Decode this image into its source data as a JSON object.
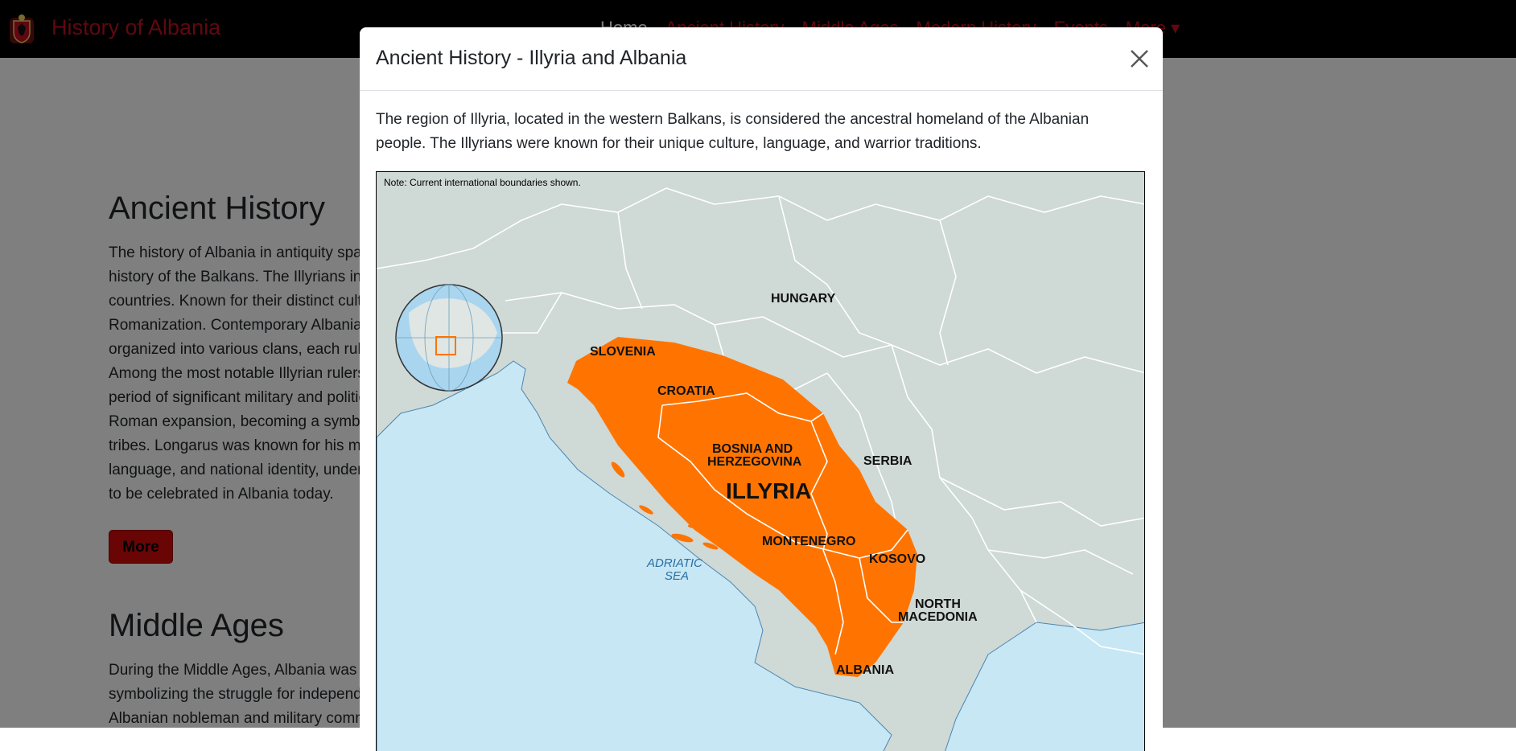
{
  "navbar": {
    "brand": "History of Albania",
    "links": [
      "Home",
      "Ancient History",
      "Middle Ages",
      "Modern History",
      "Events",
      "More ▾"
    ]
  },
  "page": {
    "sections": [
      {
        "title": "Ancient History",
        "lines": [
          "The history of Albania in antiquity spans from the Illyrians, an ancient group of tribes who played a significant role in the",
          "history of the Balkans. The Illyrians inhabited the western Balkans, including present-day Albania and parts of the surrounding",
          "countries. Known for their distinct culture and language, the Illyrians thrived in the region from the Bronze Age until their eventual",
          "Romanization. Contemporary Albanians are considered descendants of the Illyrians and claim their heritage with pride. The Illyrian society was",
          "organized into various clans, each ruled by a chieftain, and these clans frequently allied or engaging in conflicts with one another.",
          "Among the most notable Illyrian rulers was King Bardylis, who rose to prominence with his military acumen and power, and his reign marked a",
          "period of significant military and political strength for the Illyrians. Queen Teuta is remembered for her strong leadership and defiance against",
          "Roman expansion, becoming a symbol of resistance. Another notable figure was Longarus, the leader of the Dardani, one of the prominent Illyrian",
          "tribes. Longarus was known for his military prowess. The legacy of the ancient Illyrians remains deeply ingrained in Albanian culture,",
          "language, and national identity, underscoring the continuity of the Albanian people. The heritage of these ancient tribes and their leaders continues",
          "to be celebrated in Albania today."
        ],
        "button": "More"
      },
      {
        "title": "Middle Ages",
        "lines": [
          "During the Middle Ages, Albania was a battleground for various empires. The resistance led by Skanderbeg against the Ottomans in the 15th century,",
          "symbolizing the struggle for independence, is one of the most celebrated chapters in Albanian history. Born George Kastrioti in 1405, Skanderbeg was an",
          "Albanian nobleman and military commander who was taken as a hostage by the Ottomans and converted to"
        ]
      }
    ]
  },
  "modal": {
    "title": "Ancient History - Illyria and Albania",
    "close_label": "×",
    "body": "The region of Illyria, located in the western Balkans, is considered the ancestral homeland of the Albanian people. The Illyrians were known for their unique culture, language, and warrior traditions.",
    "map": {
      "note": "Note: Current international boundaries shown.",
      "labels": {
        "hungary": "HUNGARY",
        "slovenia": "SLOVENIA",
        "croatia": "CROATIA",
        "bosnia1": "BOSNIA AND",
        "bosnia2": "HERZEGOVINA",
        "illyria": "ILLYRIA",
        "serbia": "SERBIA",
        "montenegro": "MONTENEGRO",
        "kosovo": "KOSOVO",
        "nmac1": "NORTH",
        "nmac2": "MACEDONIA",
        "albania": "ALBANIA",
        "sea1": "ADRIATIC",
        "sea2": "SEA"
      },
      "colors": {
        "land": "#cfd9d6",
        "sea": "#c8e7f5",
        "illyria": "#ff7400",
        "borders": "#ffffff",
        "coast": "#4a86b0",
        "sea_label": "#2a6fa3"
      }
    }
  }
}
